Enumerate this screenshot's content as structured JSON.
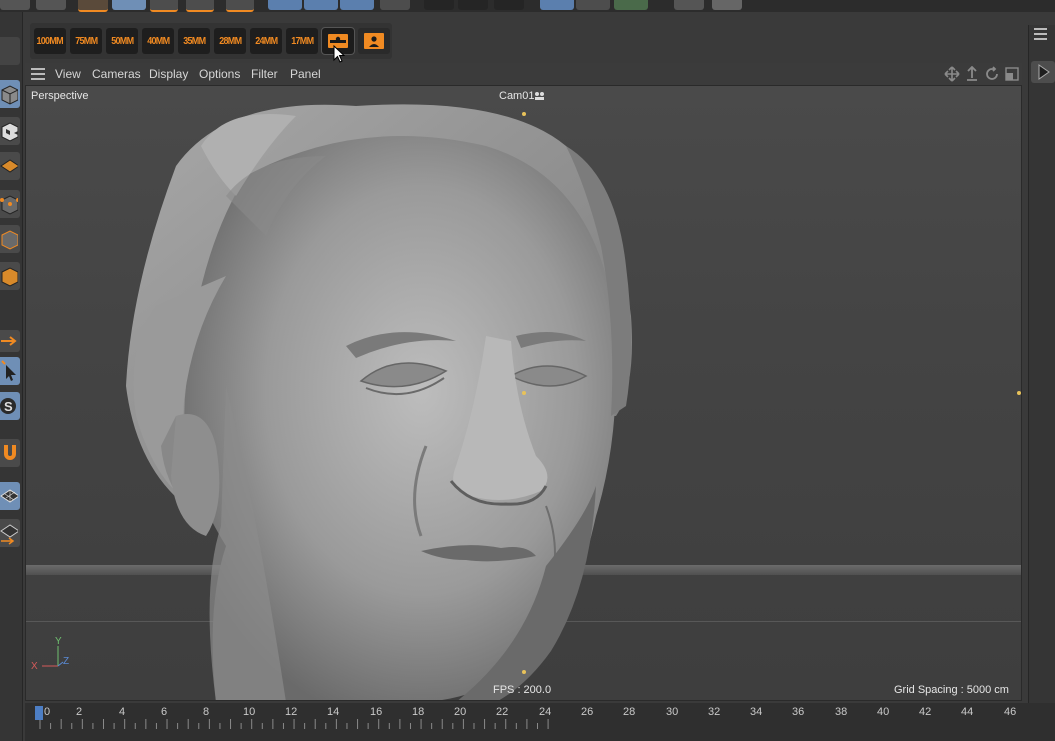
{
  "camera_toolbar": {
    "presets": [
      "100MM",
      "75MM",
      "50MM",
      "40MM",
      "35MM",
      "28MM",
      "24MM",
      "17MM"
    ],
    "icons": [
      "camera-frame-icon",
      "camera-portrait-icon"
    ]
  },
  "viewport_menu": {
    "items": [
      "View",
      "Cameras",
      "Display",
      "Options",
      "Filter",
      "Panel"
    ]
  },
  "viewport": {
    "projection": "Perspective",
    "camera": "Cam01",
    "fps": "FPS : 200.0",
    "grid_spacing": "Grid Spacing : 5000 cm",
    "axes": {
      "x": "X",
      "y": "Y",
      "z": "Z"
    }
  },
  "timeline": {
    "ticks": [
      "0",
      "2",
      "4",
      "6",
      "8",
      "10",
      "12",
      "14",
      "16",
      "18",
      "20",
      "22",
      "24",
      "26",
      "28",
      "30",
      "32",
      "34",
      "36",
      "38",
      "40",
      "42",
      "44",
      "46"
    ],
    "current_frame": 0
  },
  "colors": {
    "accent_orange": "#f08a22",
    "active_blue": "#6f8fb6",
    "handle_yellow": "#e8c25a"
  }
}
